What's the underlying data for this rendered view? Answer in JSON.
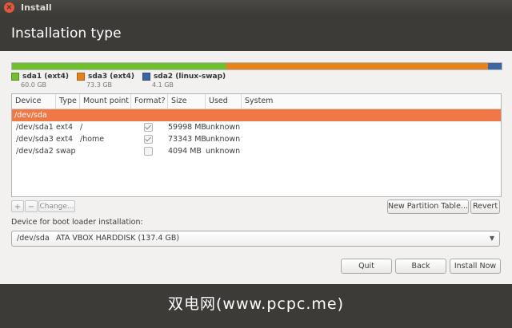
{
  "window": {
    "title": "Install",
    "close_icon": "×"
  },
  "page_title": "Installation type",
  "disk_bar": [
    {
      "fraction": 0.438,
      "color": "#6fbf2e"
    },
    {
      "fraction": 0.535,
      "color": "#e8821e"
    },
    {
      "fraction": 0.027,
      "color": "#3b66a3"
    }
  ],
  "legend": [
    {
      "name": "sda1 (ext4)",
      "size": "60.0 GB",
      "color": "#6fbf2e"
    },
    {
      "name": "sda3 (ext4)",
      "size": "73.3 GB",
      "color": "#e8821e"
    },
    {
      "name": "sda2 (linux-swap)",
      "size": "4.1 GB",
      "color": "#3b66a3"
    }
  ],
  "table": {
    "headers": {
      "device": "Device",
      "type": "Type",
      "mount": "Mount point",
      "format": "Format?",
      "size": "Size",
      "used": "Used",
      "system": "System"
    },
    "disk_row": {
      "device": "/dev/sda"
    },
    "rows": [
      {
        "device": "/dev/sda1",
        "type": "ext4",
        "mount": "/",
        "format": true,
        "size": "59998 MB",
        "used": "unknown",
        "system": ""
      },
      {
        "device": "/dev/sda3",
        "type": "ext4",
        "mount": "/home",
        "format": true,
        "size": "73343 MB",
        "used": "unknown",
        "system": ""
      },
      {
        "device": "/dev/sda2",
        "type": "swap",
        "mount": "",
        "format": false,
        "size": "4094 MB",
        "used": "unknown",
        "system": ""
      }
    ]
  },
  "toolbar": {
    "add": "+",
    "remove": "−",
    "change": "Change..."
  },
  "buttons": {
    "new_table": "New Partition Table...",
    "revert": "Revert",
    "quit": "Quit",
    "back": "Back",
    "install": "Install Now"
  },
  "boot": {
    "label": "Device for boot loader installation:",
    "device": "/dev/sda",
    "description": "ATA VBOX HARDDISK (137.4 GB)",
    "arrow": "▼"
  },
  "watermark": "双电网(www.pcpc.me)"
}
